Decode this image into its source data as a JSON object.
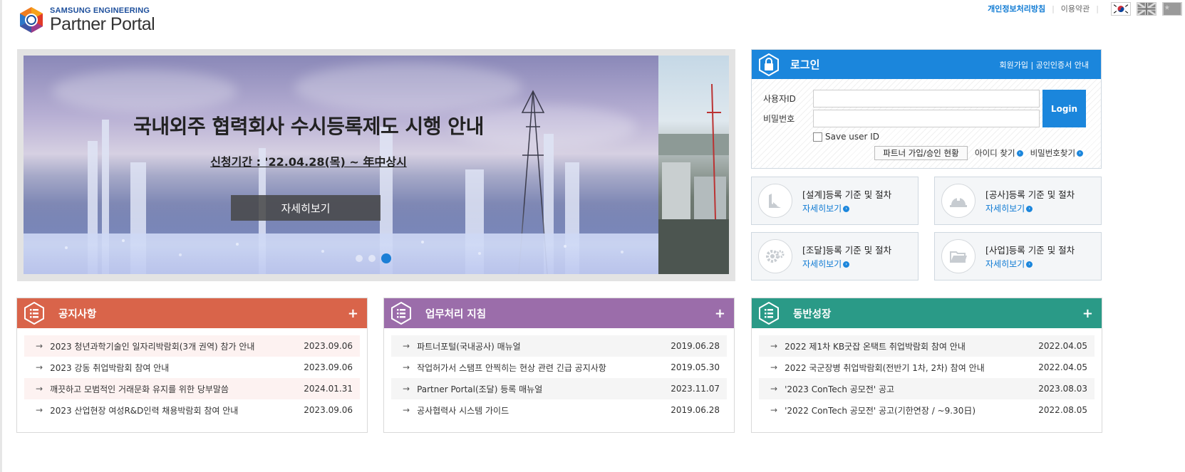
{
  "header": {
    "brand": "SAMSUNG ENGINEERING",
    "portal_name": "Partner Portal",
    "privacy_link": "개인정보처리방침",
    "terms_link": "이용약관",
    "languages": [
      "korean-flag-icon",
      "uk-flag-icon",
      "china-flag-icon"
    ]
  },
  "banner": {
    "title": "국내외주 협력회사 수시등록제도 시행 안내",
    "period": "신청기간 : '22.04.28(목) ~ 年中상시",
    "detail_button": "자세히보기",
    "slide_count": 3,
    "active_slide": 3
  },
  "login": {
    "title": "로그인",
    "top_links": "회원가입 | 공인인증서 안내",
    "user_id_label": "사용자ID",
    "password_label": "비밀번호",
    "user_id_value": "",
    "password_value": "",
    "login_button": "Login",
    "save_user_id": "Save user ID",
    "partner_status_button": "파트너 가입/승인 현황",
    "find_id": "아이디 찾기",
    "find_password": "비밀번호찾기"
  },
  "registration": [
    {
      "title": "[설계]등록 기준 및 절차",
      "link": "자세히보기",
      "icon": "drafting-icon"
    },
    {
      "title": "[공사]등록 기준 및 절차",
      "link": "자세히보기",
      "icon": "helmet-icon"
    },
    {
      "title": "[조달]등록 기준 및 절차",
      "link": "자세히보기",
      "icon": "gear-icon"
    },
    {
      "title": "[사업]등록 기준 및 절차",
      "link": "자세히보기",
      "icon": "folder-icon"
    }
  ],
  "boards": [
    {
      "title": "공지사항",
      "color": "#d9644a",
      "items": [
        {
          "text": "2023 청년과학기술인 일자리박람회(3개 권역) 참가 안내",
          "date": "2023.09.06"
        },
        {
          "text": "2023 강동 취업박람회 참여 안내",
          "date": "2023.09.06"
        },
        {
          "text": "깨끗하고 모범적인 거래문화 유지를 위한 당부말씀",
          "date": "2024.01.31"
        },
        {
          "text": "2023 산업현장 여성R&D인력 채용박람회 참여 안내",
          "date": "2023.09.06"
        }
      ]
    },
    {
      "title": "업무처리 지침",
      "color": "#9b6daa",
      "items": [
        {
          "text": "파트너포털(국내공사) 매뉴얼",
          "date": "2019.06.28"
        },
        {
          "text": "작업허가서 스탬프 안찍히는 현상 관련 긴급 공지사항",
          "date": "2019.05.30"
        },
        {
          "text": "Partner Portal(조달) 등록 매뉴얼",
          "date": "2023.11.07"
        },
        {
          "text": "공사협력사 시스템 가이드",
          "date": "2019.06.28"
        }
      ]
    },
    {
      "title": "동반성장",
      "color": "#2a9a87",
      "items": [
        {
          "text": "2022 제1차 KB굿잡 온택트 취업박람회 참여 안내",
          "date": "2022.04.05"
        },
        {
          "text": "2022 국군장병 취업박람회(전반기 1차, 2차) 참여 안내",
          "date": "2022.04.05"
        },
        {
          "text": "'2023 ConTech 공모전' 공고",
          "date": "2023.08.03"
        },
        {
          "text": "'2022 ConTech 공모전' 공고(기한연장 / ~9.30日)",
          "date": "2022.08.05"
        }
      ]
    }
  ]
}
